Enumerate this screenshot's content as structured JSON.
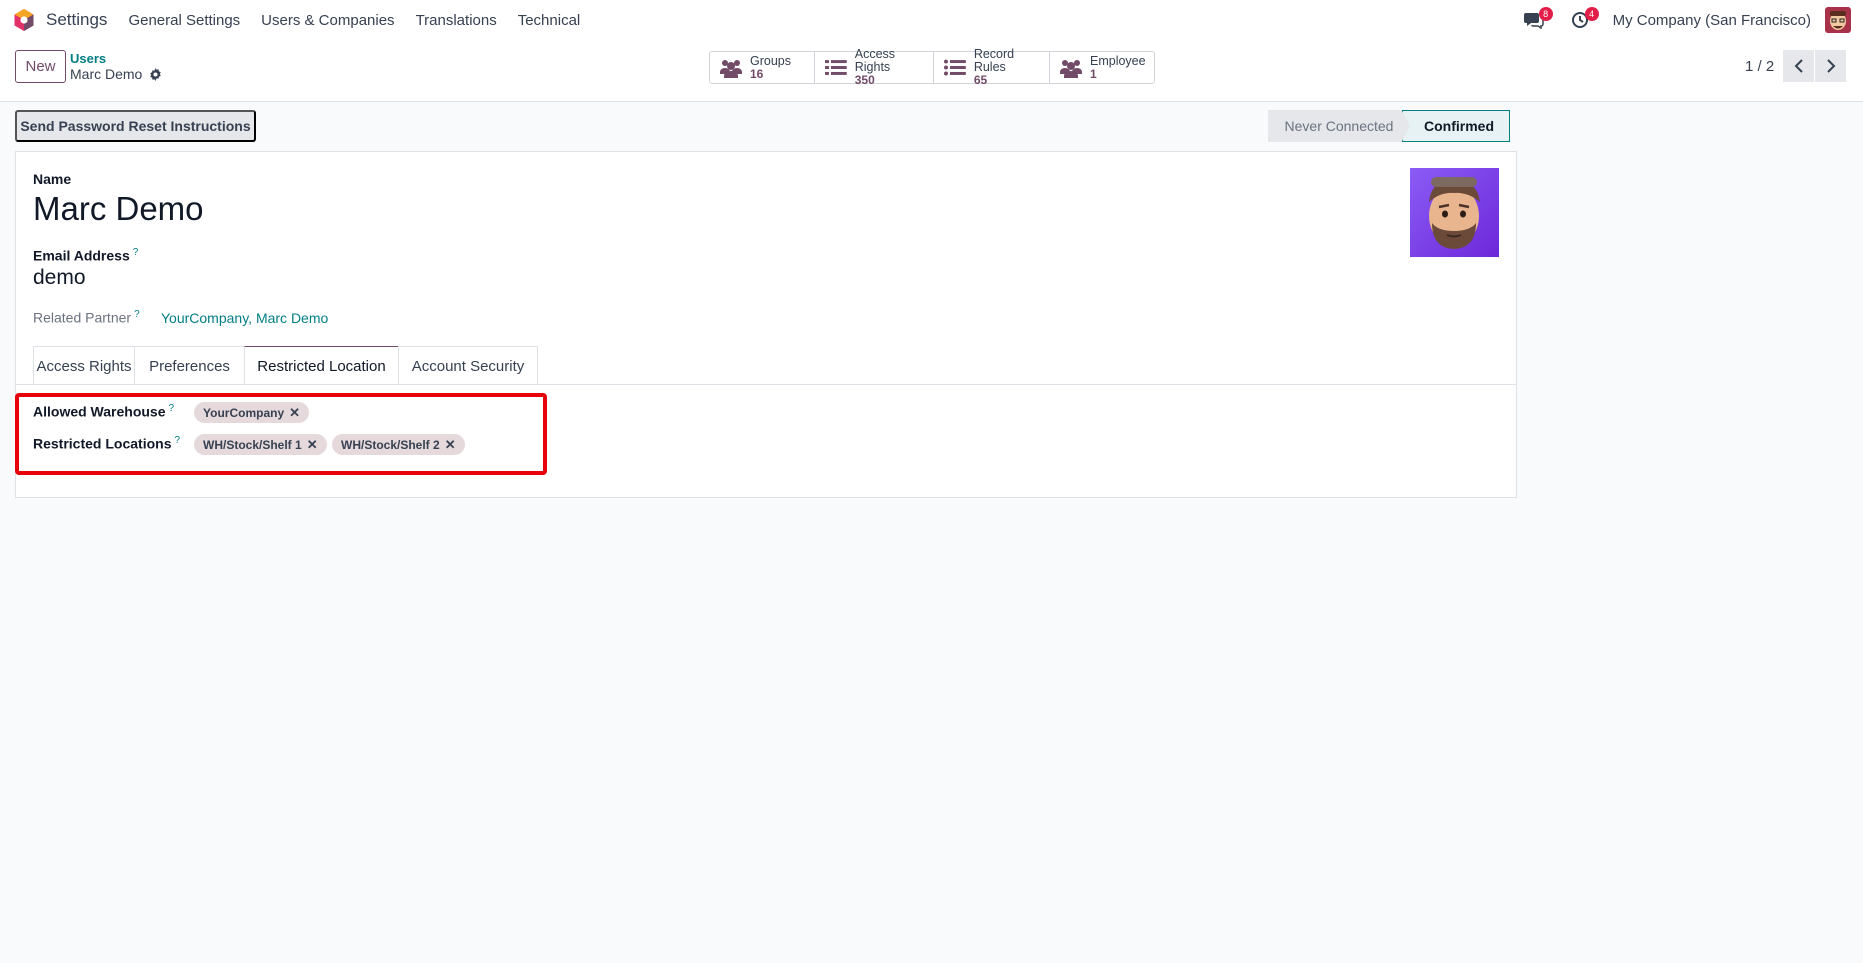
{
  "navbar": {
    "app_name": "Settings",
    "menus": [
      "General Settings",
      "Users & Companies",
      "Translations",
      "Technical"
    ],
    "messages_badge": "8",
    "activities_badge": "4",
    "company": "My Company (San Francisco)"
  },
  "control": {
    "new_label": "New",
    "breadcrumb_parent": "Users",
    "breadcrumb_current": "Marc Demo",
    "stats": [
      {
        "label": "Groups",
        "value": "16",
        "icon": "users-icon"
      },
      {
        "label": "Access Rights",
        "value": "350",
        "icon": "list-icon"
      },
      {
        "label": "Record Rules",
        "value": "65",
        "icon": "list-icon"
      },
      {
        "label": "Employee",
        "value": "1",
        "icon": "users-icon"
      }
    ],
    "pager": "1 / 2"
  },
  "header": {
    "reset_button": "Send Password Reset Instructions",
    "status_steps": [
      "Never Connected",
      "Confirmed"
    ],
    "active_status": "Confirmed"
  },
  "form": {
    "name_label": "Name",
    "name_value": "Marc Demo",
    "email_label": "Email Address",
    "email_value": "demo",
    "partner_label": "Related Partner",
    "partner_value": "YourCompany, Marc Demo",
    "help_mark": "?"
  },
  "tabs": [
    "Access Rights",
    "Preferences",
    "Restricted Location",
    "Account Security"
  ],
  "active_tab": "Restricted Location",
  "restricted": {
    "warehouse_label": "Allowed Warehouse",
    "warehouse_tags": [
      "YourCompany"
    ],
    "locations_label": "Restricted Locations",
    "location_tags": [
      "WH/Stock/Shelf 1",
      "WH/Stock/Shelf 2"
    ],
    "remove_glyph": "✕"
  },
  "colors": {
    "brand": "#714b67",
    "accent": "#017e84",
    "badge": "#e11d48",
    "highlight": "#e8000a"
  }
}
